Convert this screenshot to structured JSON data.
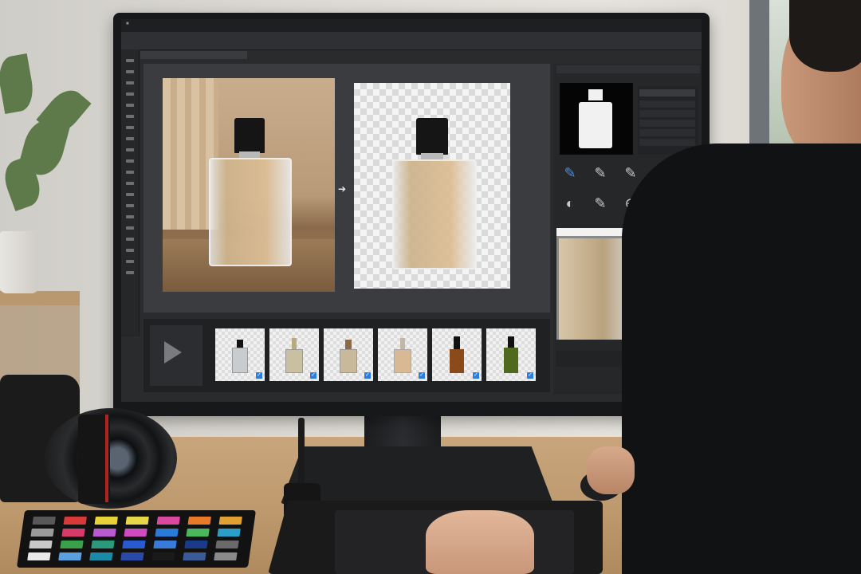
{
  "app": {
    "menu": [
      "",
      "",
      "",
      "",
      "",
      "",
      "",
      "",
      "",
      ""
    ],
    "document_tab": ""
  },
  "thumbnails": [
    {
      "color": "#c9ccce",
      "cap": "#111111",
      "checked": true
    },
    {
      "color": "#c8c0a0",
      "cap": "#b8aa7a",
      "checked": true
    },
    {
      "color": "#c7b999",
      "cap": "#8a6a48",
      "checked": true
    },
    {
      "color": "#d9b894",
      "cap": "#c4b6a4",
      "checked": true
    },
    {
      "color": "#8a4a1a",
      "cap": "#111111",
      "checked": true
    },
    {
      "color": "#4f6a1e",
      "cap": "#111111",
      "checked": true
    }
  ],
  "color_checker": [
    "#585858",
    "#d83a3a",
    "#e7d23a",
    "#e8d64a",
    "#d84aa0",
    "#e87a2a",
    "#e0a032",
    "#9a9a9a",
    "#d83a6a",
    "#b85ad0",
    "#d04ac0",
    "#2a7ad8",
    "#4ab85a",
    "#2aa0c8",
    "#c8c8c8",
    "#3aa04a",
    "#2a9a7a",
    "#2a5ad0",
    "#3a7ad8",
    "#1a3a8a",
    "#6a6a6a",
    "#e8e8e8",
    "#5aa0e0",
    "#1a8aa8",
    "#2a4aa8",
    "#1a1a1a",
    "#3a5a9a",
    "#8a8a8a"
  ],
  "accent": "#2a7de1",
  "icons": [
    "play-icon",
    "arrow-right-icon",
    "brush-icon",
    "eyedropper-icon",
    "target-icon",
    "dial-icon",
    "checkbox-icon"
  ]
}
